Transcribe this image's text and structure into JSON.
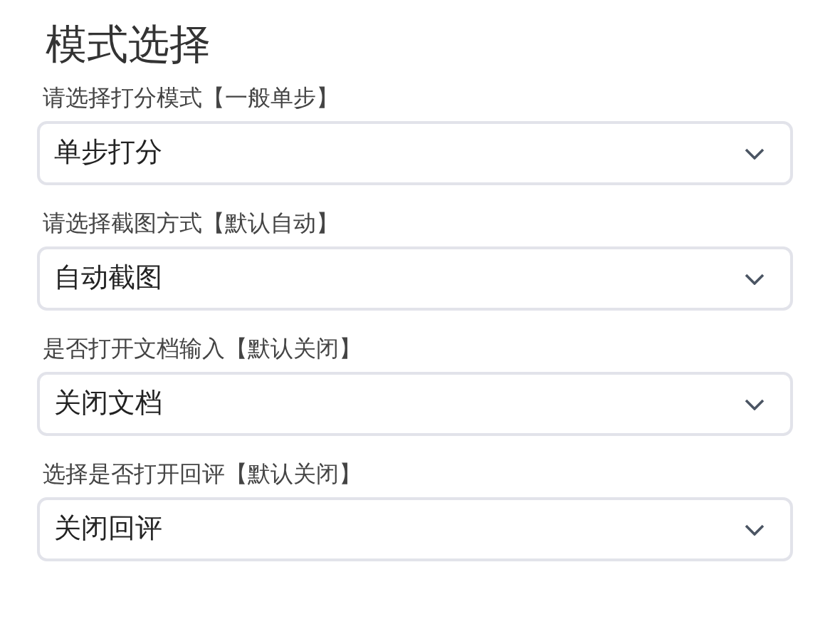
{
  "title": "模式选择",
  "fields": [
    {
      "label": "请选择打分模式【一般单步】",
      "value": "单步打分"
    },
    {
      "label": "请选择截图方式【默认自动】",
      "value": "自动截图"
    },
    {
      "label": "是否打开文档输入【默认关闭】",
      "value": "关闭文档"
    },
    {
      "label": "选择是否打开回评【默认关闭】",
      "value": "关闭回评"
    }
  ]
}
